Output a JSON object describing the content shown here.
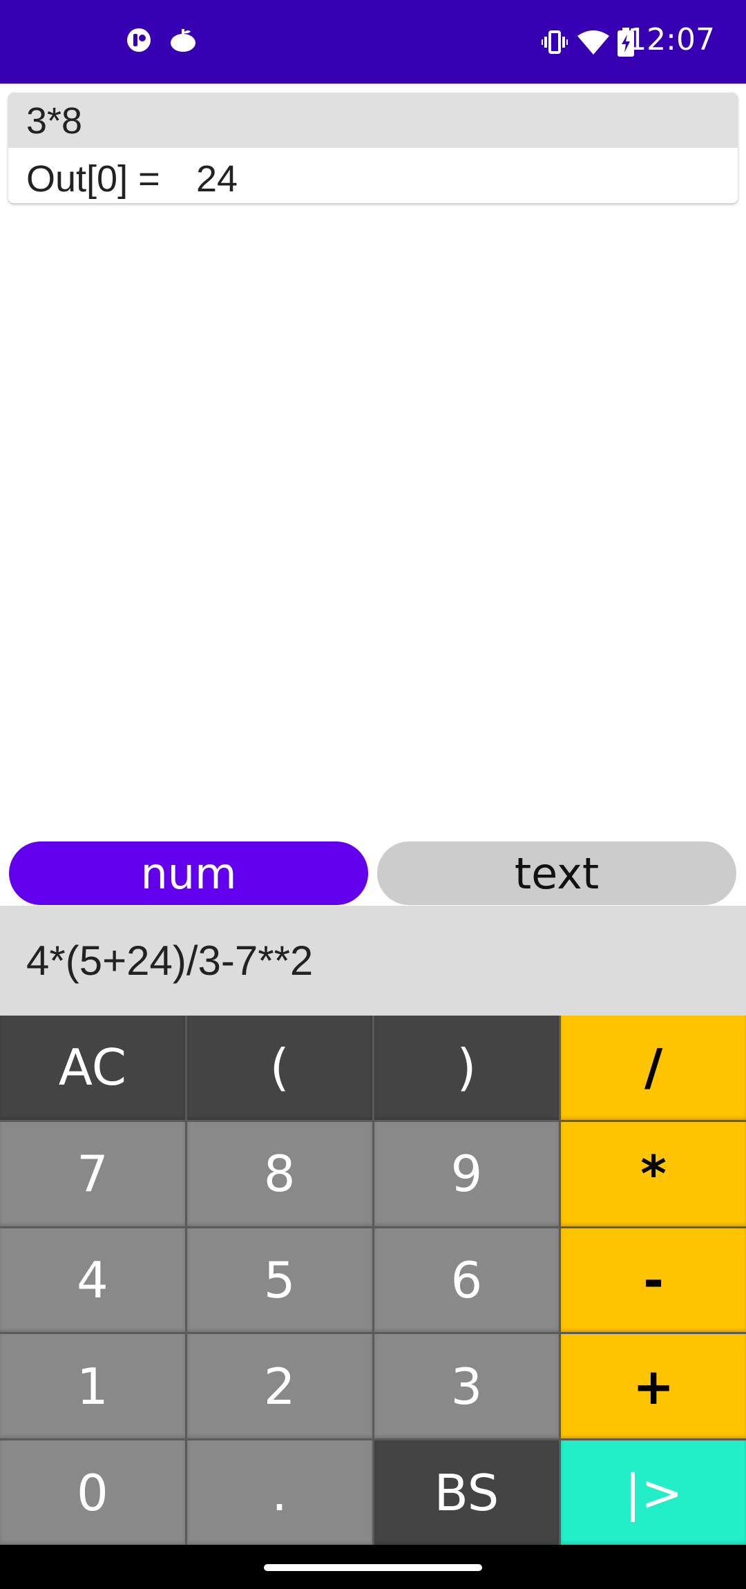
{
  "status_bar": {
    "time": "12:07",
    "left_icons": [
      "notification-app-icon",
      "notification-app-icon-2"
    ],
    "right_icons": [
      "vibrate-icon",
      "wifi-icon",
      "battery-charging-icon"
    ],
    "background_color": "#3700b3"
  },
  "history": {
    "input": "3*8",
    "output_label": "Out[0] =",
    "output_value": "24"
  },
  "mode_toggle": {
    "num_label": "num",
    "text_label": "text",
    "selected": "num",
    "selected_color": "#6200ee"
  },
  "expression": "4*(5+24)/3-7**2",
  "keypad": {
    "ac": "AC",
    "open_paren": "(",
    "close_paren": ")",
    "divide": "/",
    "seven": "7",
    "eight": "8",
    "nine": "9",
    "multiply": "*",
    "four": "4",
    "five": "5",
    "six": "6",
    "minus": "-",
    "one": "1",
    "two": "2",
    "three": "3",
    "plus": "+",
    "zero": "0",
    "dot": ".",
    "backspace": "BS",
    "execute": "|>",
    "operator_color": "#ffc400",
    "execute_color": "#22eec8"
  }
}
